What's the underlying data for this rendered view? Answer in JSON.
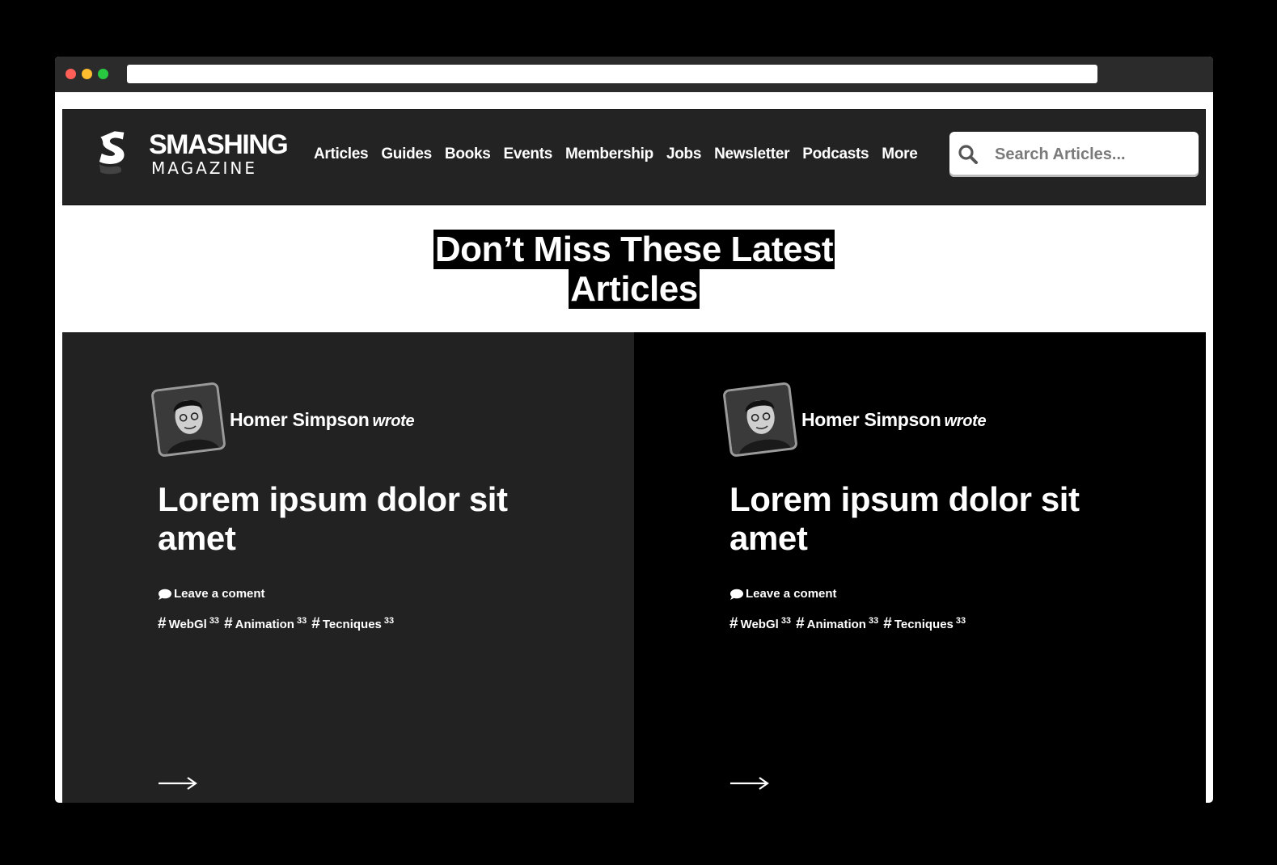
{
  "logo": {
    "line1": "SMASHING",
    "line2": "MAGAZINE"
  },
  "nav": {
    "items": [
      "Articles",
      "Guides",
      "Books",
      "Events",
      "Membership",
      "Jobs",
      "Newsletter",
      "Podcasts",
      "More"
    ]
  },
  "search": {
    "placeholder": "Search Articles...",
    "icon": "search-icon"
  },
  "headline": {
    "line1": "Don’t Miss These Latest",
    "line2": "Articles"
  },
  "cards": [
    {
      "author": "Homer Simpson",
      "wrote": "wrote",
      "title": "Lorem ipsum dolor sit amet",
      "comment": "Leave a coment",
      "tags": [
        {
          "name": "WebGl",
          "count": "33"
        },
        {
          "name": "Animation",
          "count": "33"
        },
        {
          "name": "Tecniques",
          "count": "33"
        }
      ],
      "background": "#222222"
    },
    {
      "author": "Homer Simpson",
      "wrote": "wrote",
      "title": "Lorem ipsum dolor sit amet",
      "comment": "Leave a coment",
      "tags": [
        {
          "name": "WebGl",
          "count": "33"
        },
        {
          "name": "Animation",
          "count": "33"
        },
        {
          "name": "Tecniques",
          "count": "33"
        }
      ],
      "background": "#000000"
    }
  ],
  "colors": {
    "nav_bg": "#232323",
    "page_bg": "#ffffff",
    "accent_text": "#ffffff"
  }
}
